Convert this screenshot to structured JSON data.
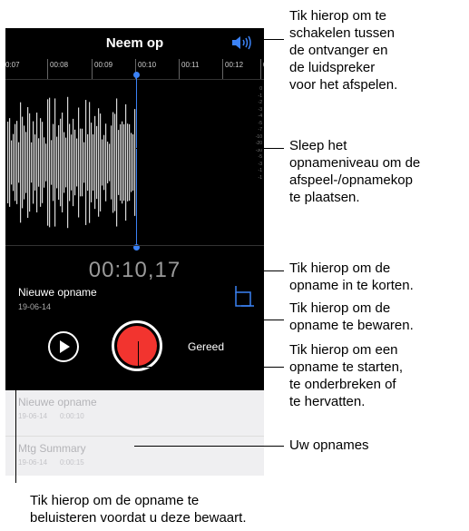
{
  "phone": {
    "title": "Neem op",
    "ruler": [
      "0:07",
      "00:08",
      "00:09",
      "00:10",
      "00:11",
      "00:12",
      "0"
    ],
    "levels": [
      "0",
      "-1",
      "-2",
      "-3",
      "-4",
      "-5",
      "-7",
      "-10",
      "-20",
      "-30",
      "-5",
      "-3",
      "-1",
      "-1"
    ],
    "timer": "00:10,17",
    "recording": {
      "name": "Nieuwe opname",
      "date": "19-06-14"
    },
    "done_label": "Gereed",
    "list": [
      {
        "title": "Nieuwe opname",
        "date": "19-06-14",
        "duration": "0:00:10"
      },
      {
        "title": "Mtg Summary",
        "date": "19-06-14",
        "duration": "0:00:15"
      }
    ],
    "accent_color": "#3b82f6",
    "record_color": "#f2342f"
  },
  "callouts": {
    "speaker": [
      "Tik hierop om te",
      "schakelen tussen",
      "de ontvanger en",
      "de luidspreker",
      "voor het afspelen."
    ],
    "playhead": [
      "Sleep het",
      "opnameniveau om de",
      "afspeel-/opnamekop",
      "te plaatsen."
    ],
    "trim": [
      "Tik hierop om de",
      "opname in te korten."
    ],
    "done": [
      "Tik hierop om de",
      "opname te bewaren."
    ],
    "record": [
      "Tik hierop om een",
      "opname te starten,",
      "te onderbreken of",
      "te hervatten."
    ],
    "recordings": [
      "Uw opnames"
    ],
    "play": [
      "Tik hierop om de opname te",
      "beluisteren voordat u deze bewaart."
    ]
  }
}
